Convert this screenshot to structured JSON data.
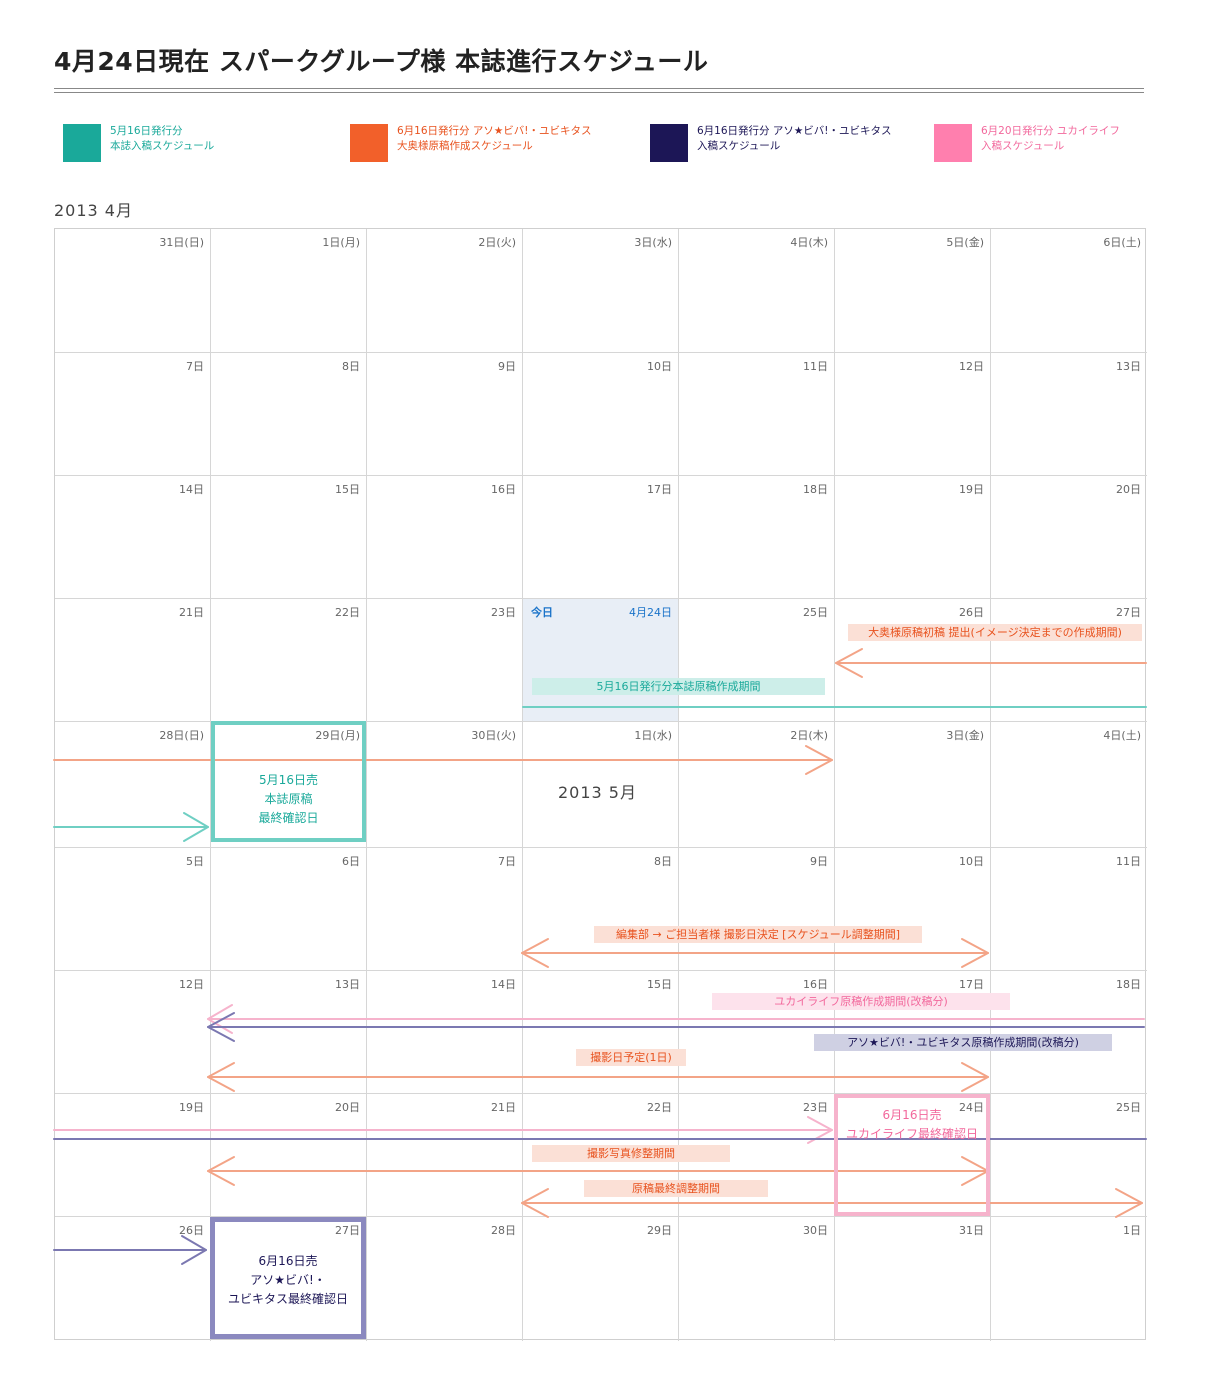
{
  "title": "4月24日現在 スパークグループ様 本誌進行スケジュール",
  "legend": [
    {
      "color": "#1aa99a",
      "text_color": "#1aa99a",
      "line1": "5月16日発行分",
      "line2": "本誌入稿スケジュール"
    },
    {
      "color": "#f2602a",
      "text_color": "#e8521e",
      "line1": "6月16日発行分 アソ★ビバ!・ユビキタス",
      "line2": "大奥様原稿作成スケジュール"
    },
    {
      "color": "#1c1656",
      "text_color": "#1c1656",
      "line1": "6月16日発行分 アソ★ビバ!・ユビキタス",
      "line2": "入稿スケジュール"
    },
    {
      "color": "#ff7fae",
      "text_color": "#f2689c",
      "line1": "6月20日発行分 ユカイライフ",
      "line2": "入稿スケジュール"
    }
  ],
  "month_april": "2013 4月",
  "month_may": "2013 5月",
  "weeks": [
    [
      "31日(日)",
      "1日(月)",
      "2日(火)",
      "3日(水)",
      "4日(木)",
      "5日(金)",
      "6日(土)"
    ],
    [
      "7日",
      "8日",
      "9日",
      "10日",
      "11日",
      "12日",
      "13日"
    ],
    [
      "14日",
      "15日",
      "16日",
      "17日",
      "18日",
      "19日",
      "20日"
    ],
    [
      "21日",
      "22日",
      "23日",
      "",
      "25日",
      "26日",
      "27日"
    ],
    [
      "28日(日)",
      "29日(月)",
      "30日(火)",
      "1日(水)",
      "2日(木)",
      "3日(金)",
      "4日(土)"
    ],
    [
      "5日",
      "6日",
      "7日",
      "8日",
      "9日",
      "10日",
      "11日"
    ],
    [
      "12日",
      "13日",
      "14日",
      "15日",
      "16日",
      "17日",
      "18日"
    ],
    [
      "19日",
      "20日",
      "21日",
      "22日",
      "23日",
      "24日",
      "25日"
    ],
    [
      "26日",
      "27日",
      "28日",
      "29日",
      "30日",
      "31日",
      "1日"
    ]
  ],
  "today": {
    "label": "今日",
    "date": "4月24日"
  },
  "events": {
    "ooku_draft": "大奥様原稿初稿 提出(イメージ決定までの作成期間)",
    "may16_draft": "5月16日発行分本誌原稿作成期間",
    "shoot_date_decision": "編集部 → ご担当者様 撮影日決定 [スケジュール調整期間]",
    "yukai_draft": "ユカイライフ原稿作成期間(改稿分)",
    "aso_draft": "アソ★ビバ!・ユビキタス原稿作成期間(改稿分)",
    "shoot_day": "撮影日予定(1日)",
    "photo_retouch": "撮影写真修整期間",
    "final_adjust": "原稿最終調整期間"
  },
  "boxes": {
    "may16_final": "5月16日売\n本誌原稿\n最終確認日",
    "yukai_final": "6月16日売\nユカイライフ最終確認日",
    "aso_final": "6月16日売\nアソ★ビバ!・\nユビキタス最終確認日"
  },
  "colors": {
    "teal": "#6fcfc3",
    "teal_dark": "#3fb7a8",
    "orange": "#f3a487",
    "navy": "#7b78b1",
    "pink": "#f6b3cc"
  }
}
